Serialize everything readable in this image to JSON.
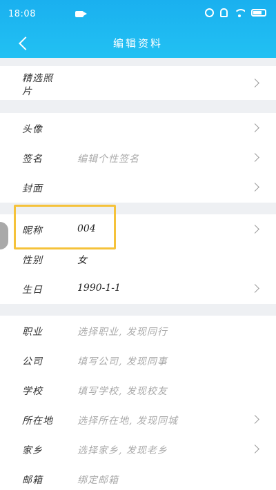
{
  "status_bar": {
    "time": "18:08"
  },
  "nav": {
    "title": "编辑资料"
  },
  "photos": {
    "label_line1": "精选照",
    "label_line2": "片"
  },
  "rows": {
    "avatar": {
      "label": "头像"
    },
    "signature": {
      "label": "签名",
      "placeholder": "编辑个性签名"
    },
    "cover": {
      "label": "封面"
    },
    "nickname": {
      "label": "昵称",
      "value": "004"
    },
    "gender": {
      "label": "性别",
      "value": "女"
    },
    "birthday": {
      "label": "生日",
      "value": "1990-1-1"
    },
    "job": {
      "label": "职业",
      "placeholder": "选择职业, 发现同行"
    },
    "company": {
      "label": "公司",
      "placeholder": "填写公司, 发现同事"
    },
    "school": {
      "label": "学校",
      "placeholder": "填写学校, 发现校友"
    },
    "location": {
      "label": "所在地",
      "placeholder": "选择所在地, 发现同城"
    },
    "hometown": {
      "label": "家乡",
      "placeholder": "选择家乡, 发现老乡"
    },
    "email": {
      "label": "邮箱",
      "placeholder": "绑定邮箱"
    }
  },
  "colors": {
    "header": "#1ab0ef",
    "highlight": "#f5c23a"
  }
}
